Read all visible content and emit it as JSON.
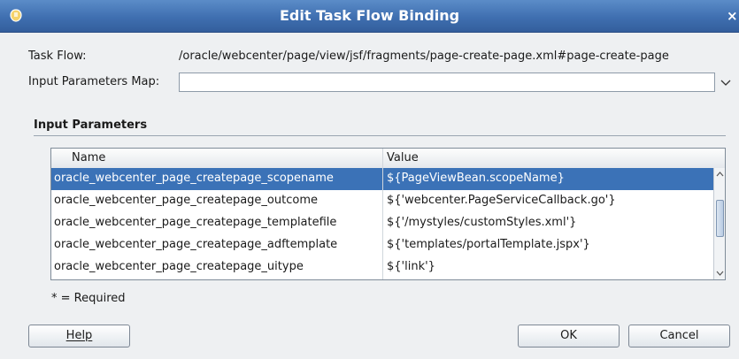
{
  "window": {
    "title": "Edit Task Flow Binding",
    "icon": "app-icon",
    "close_label": "×"
  },
  "form": {
    "task_flow_label": "Task Flow:",
    "task_flow_value": "/oracle/webcenter/page/view/jsf/fragments/page-create-page.xml#page-create-page",
    "input_map_label": "Input Parameters Map:",
    "input_map_value": ""
  },
  "section": {
    "title": "Input Parameters"
  },
  "table": {
    "columns": [
      "Name",
      "Value"
    ],
    "rows": [
      {
        "name": "oracle_webcenter_page_createpage_scopename",
        "value": "${PageViewBean.scopeName}",
        "selected": true
      },
      {
        "name": "oracle_webcenter_page_createpage_outcome",
        "value": "${'webcenter.PageServiceCallback.go'}",
        "selected": false
      },
      {
        "name": "oracle_webcenter_page_createpage_templatefile",
        "value": "${'/mystyles/customStyles.xml'}",
        "selected": false
      },
      {
        "name": "oracle_webcenter_page_createpage_adftemplate",
        "value": "${'templates/portalTemplate.jspx'}",
        "selected": false
      },
      {
        "name": "oracle_webcenter_page_createpage_uitype",
        "value": "${'link'}",
        "selected": false
      }
    ]
  },
  "required_note": "* = Required",
  "buttons": {
    "help": "Help",
    "ok": "OK",
    "cancel": "Cancel"
  },
  "colors": {
    "title_bar": "#3f6fb0",
    "selection": "#3b72b7",
    "background": "#eef0f2"
  }
}
